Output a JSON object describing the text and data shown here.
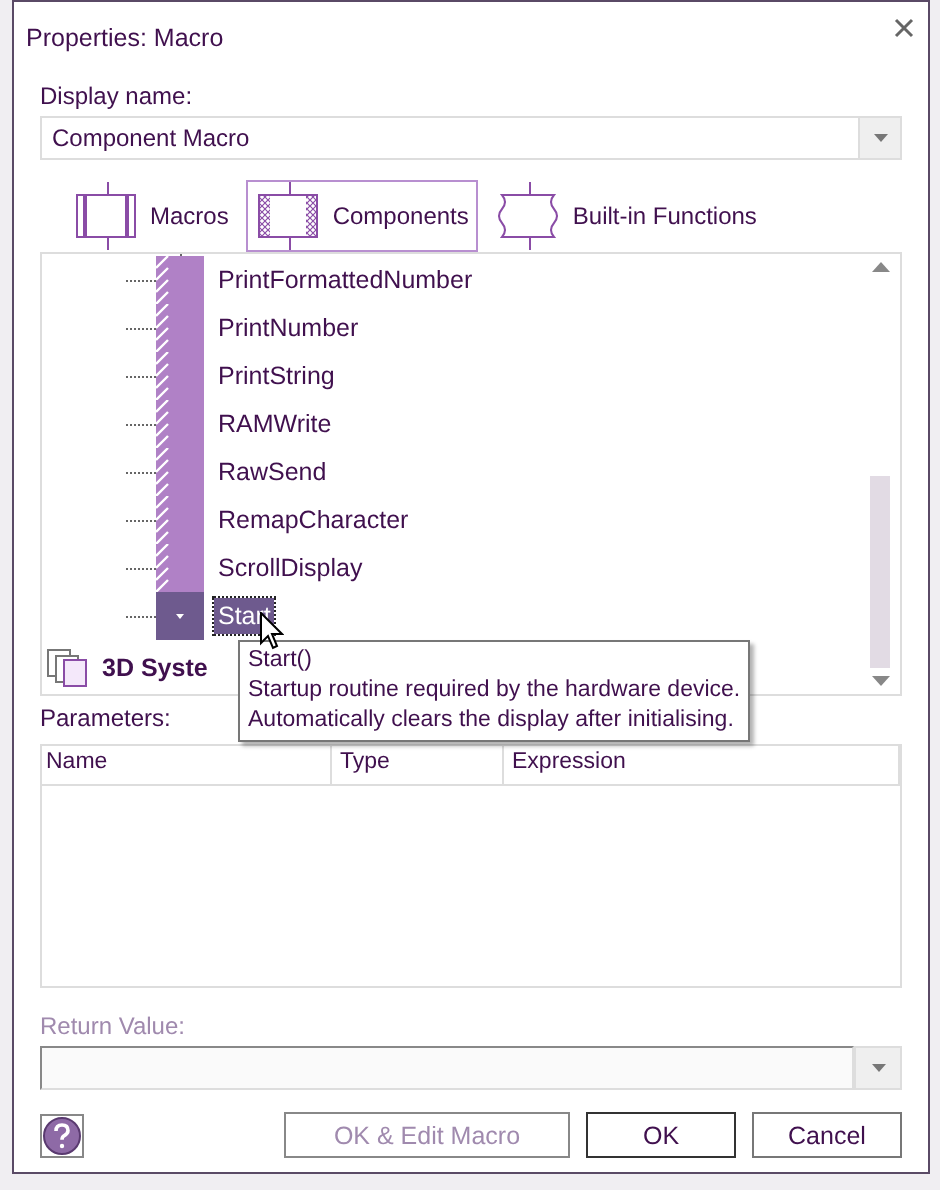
{
  "window": {
    "title": "Properties: Macro"
  },
  "display_name": {
    "label": "Display name:",
    "value": "Component Macro"
  },
  "tabs": [
    {
      "label": "Macros",
      "kind": "macros",
      "selected": false
    },
    {
      "label": "Components",
      "kind": "components",
      "selected": true
    },
    {
      "label": "Built-in Functions",
      "kind": "builtin",
      "selected": false
    }
  ],
  "tree": {
    "items": [
      {
        "label": "PrintFormattedNumber",
        "selected": false
      },
      {
        "label": "PrintNumber",
        "selected": false
      },
      {
        "label": "PrintString",
        "selected": false
      },
      {
        "label": "RAMWrite",
        "selected": false
      },
      {
        "label": "RawSend",
        "selected": false
      },
      {
        "label": "RemapCharacter",
        "selected": false
      },
      {
        "label": "ScrollDisplay",
        "selected": false
      },
      {
        "label": "Start",
        "selected": true
      }
    ],
    "group": {
      "label": "3D Syste"
    }
  },
  "tooltip": {
    "title": "Start()",
    "lines": [
      "Startup routine required by the hardware device.",
      "Automatically clears the display after initialising."
    ]
  },
  "parameters": {
    "label": "Parameters:",
    "columns": [
      "Name",
      "Type",
      "Expression"
    ]
  },
  "return_value": {
    "label": "Return Value:",
    "disabled": true
  },
  "buttons": [
    {
      "label": "OK & Edit Macro",
      "disabled": true,
      "default": false
    },
    {
      "label": "OK",
      "disabled": false,
      "default": true
    },
    {
      "label": "Cancel",
      "disabled": false,
      "default": false
    }
  ]
}
